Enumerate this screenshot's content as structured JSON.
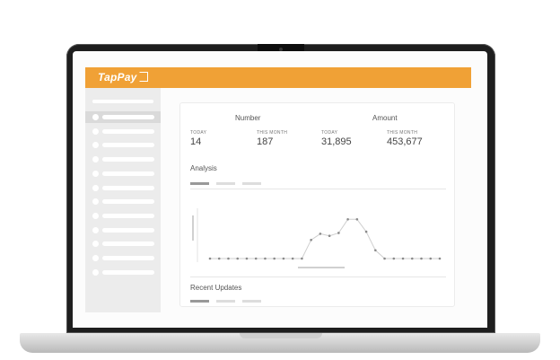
{
  "app": {
    "brand": "TapPay"
  },
  "sidebar": {
    "item_count": 12,
    "active_index": 0
  },
  "stats": {
    "groups": [
      {
        "title": "Number"
      },
      {
        "title": "Amount"
      }
    ],
    "items": [
      {
        "caption": "TODAY",
        "value": "14"
      },
      {
        "caption": "THIS MONTH",
        "value": "187"
      },
      {
        "caption": "TODAY",
        "value": "31,895"
      },
      {
        "caption": "THIS MONTH",
        "value": "453,677"
      }
    ]
  },
  "analysis": {
    "title": "Analysis"
  },
  "recent": {
    "title": "Recent Updates"
  },
  "chart_data": {
    "type": "line",
    "title": "",
    "xlabel": "",
    "ylabel": "",
    "x": [
      1,
      2,
      3,
      4,
      5,
      6,
      7,
      8,
      9,
      10,
      11,
      12,
      13,
      14,
      15,
      16,
      17,
      18,
      19,
      20,
      21,
      22,
      23,
      24,
      25,
      26
    ],
    "values": [
      0,
      0,
      0,
      0,
      0,
      0,
      0,
      0,
      0,
      0,
      0,
      0.45,
      0.6,
      0.55,
      0.62,
      0.95,
      0.95,
      0.65,
      0.2,
      0,
      0,
      0,
      0,
      0,
      0,
      0
    ],
    "ylim": [
      0,
      1
    ],
    "grid": false
  },
  "colors": {
    "accent": "#f0a136"
  }
}
